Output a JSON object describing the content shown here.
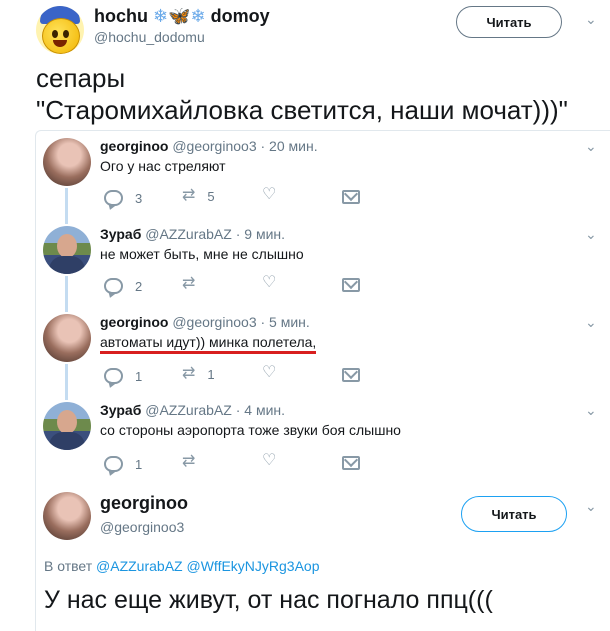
{
  "header": {
    "name_left": "hochu",
    "name_right": "domoy",
    "handle": "@hochu_dodomu",
    "follow_label": "Читать"
  },
  "tweet": {
    "line1": "сепары",
    "line2": "\"Старомихайловка светится, наши мочат)))\""
  },
  "thread": [
    {
      "name": "georginoo",
      "handle": "@georginoo3",
      "time": "· 20 мин.",
      "text": "Ого у нас стреляют",
      "replies": "3",
      "retweets": "5",
      "likes": ""
    },
    {
      "name": "Зураб",
      "handle": "@AZZurabAZ",
      "time": "· 9 мин.",
      "text": "не может быть, мне не слышно",
      "replies": "2",
      "retweets": "",
      "likes": ""
    },
    {
      "name": "georginoo",
      "handle": "@georginoo3",
      "time": "· 5 мин.",
      "text": "автоматы идут)) минка полетела,",
      "replies": "1",
      "retweets": "1",
      "likes": ""
    },
    {
      "name": "Зураб",
      "handle": "@AZZurabAZ",
      "time": "· 4 мин.",
      "text": "со стороны аэропорта тоже звуки боя слышно",
      "replies": "1",
      "retweets": "",
      "likes": ""
    }
  ],
  "bottom": {
    "name": "georginoo",
    "handle": "@georginoo3",
    "follow_label": "Читать",
    "reply_prefix": "В ответ",
    "reply_to_1": "@AZZurabAZ",
    "reply_to_2": "@WffEkyNJyRg3Aop",
    "text": "У нас еще живут, от нас погнало ппц((("
  },
  "icons": [
    "snowflake-icon",
    "butterfly-icon",
    "chevron-down-icon",
    "reply-icon",
    "retweet-icon",
    "like-icon",
    "message-icon"
  ],
  "colors": {
    "link": "#1b95e0",
    "underline": "#d81f1f",
    "muted": "#657786",
    "thread_line": "#c4dcf1"
  }
}
